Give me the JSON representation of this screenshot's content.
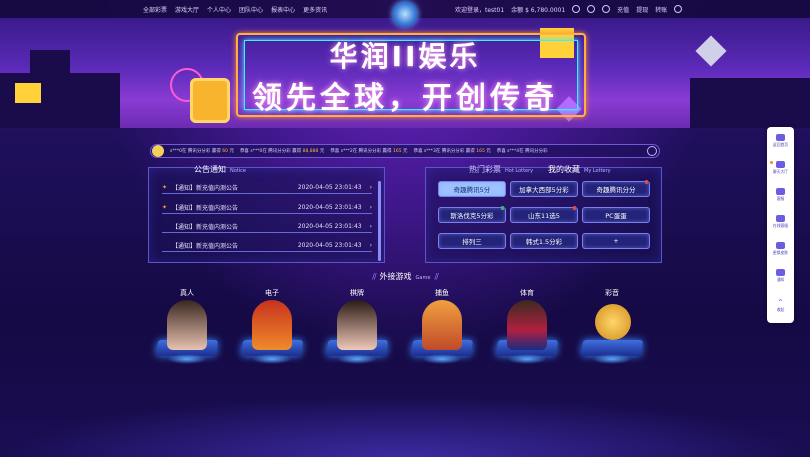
{
  "topbar": {
    "nav": [
      "全部彩票",
      "游戏大厅",
      "个人中心",
      "团队中心",
      "报表中心",
      "更多资讯"
    ],
    "welcome": "欢迎登录，test01",
    "balance": "余额 $ 6,780.0001",
    "actions": [
      "充值",
      "提现",
      "转账"
    ]
  },
  "banner": {
    "line1": "华润II娱乐",
    "line2": "领先全球，开创传奇"
  },
  "ticker": [
    {
      "text": "s***0在 腾讯分分彩 赢得",
      "amount": "60",
      "unit": "元"
    },
    {
      "text": "恭喜 s***0在 腾讯分分彩 赢得",
      "amount": "88,888",
      "unit": "元"
    },
    {
      "text": "恭喜 s***2在 腾讯分分彩 赢得",
      "amount": "165",
      "unit": "元"
    },
    {
      "text": "恭喜 s***3在 腾讯分分彩 赢得",
      "amount": "165",
      "unit": "元"
    },
    {
      "text": "恭喜 s***4在 腾讯分分彩",
      "amount": "",
      "unit": ""
    }
  ],
  "notice": {
    "title": "公告通知",
    "subtitle": "Notice",
    "items": [
      {
        "text": "【通知】新充值内测公告",
        "date": "2020-04-05 23:01:43"
      },
      {
        "text": "【通知】新充值内测公告",
        "date": "2020-04-05 23:01:43"
      },
      {
        "text": "【通知】新充值内测公告",
        "date": "2020-04-05 23:01:43"
      },
      {
        "text": "【通知】新充值内测公告",
        "date": "2020-04-05 23:01:43"
      }
    ]
  },
  "lottery": {
    "hot_title": "热门彩票",
    "hot_sub": "Hot Lottery",
    "fav_title": "我的收藏",
    "fav_sub": "My Lottery",
    "buttons": [
      "奇趣腾讯5分",
      "加拿大西部5分彩",
      "奇趣腾讯分分",
      "斯洛伐克5分彩",
      "山东11选5",
      "PC蛋蛋",
      "排列三",
      "韩式1.5分彩",
      "+"
    ]
  },
  "games": {
    "title": "外接游戏",
    "subtitle": "Game",
    "items": [
      "真人",
      "电子",
      "棋牌",
      "捕鱼",
      "体育",
      "彩音"
    ]
  },
  "side": [
    "返回首页",
    "聊天大厅",
    "客服",
    "在线客服",
    "更换皮肤",
    "通知",
    "收起"
  ],
  "colors": {
    "accent": "#6b5de0",
    "gold": "#ffb347"
  }
}
